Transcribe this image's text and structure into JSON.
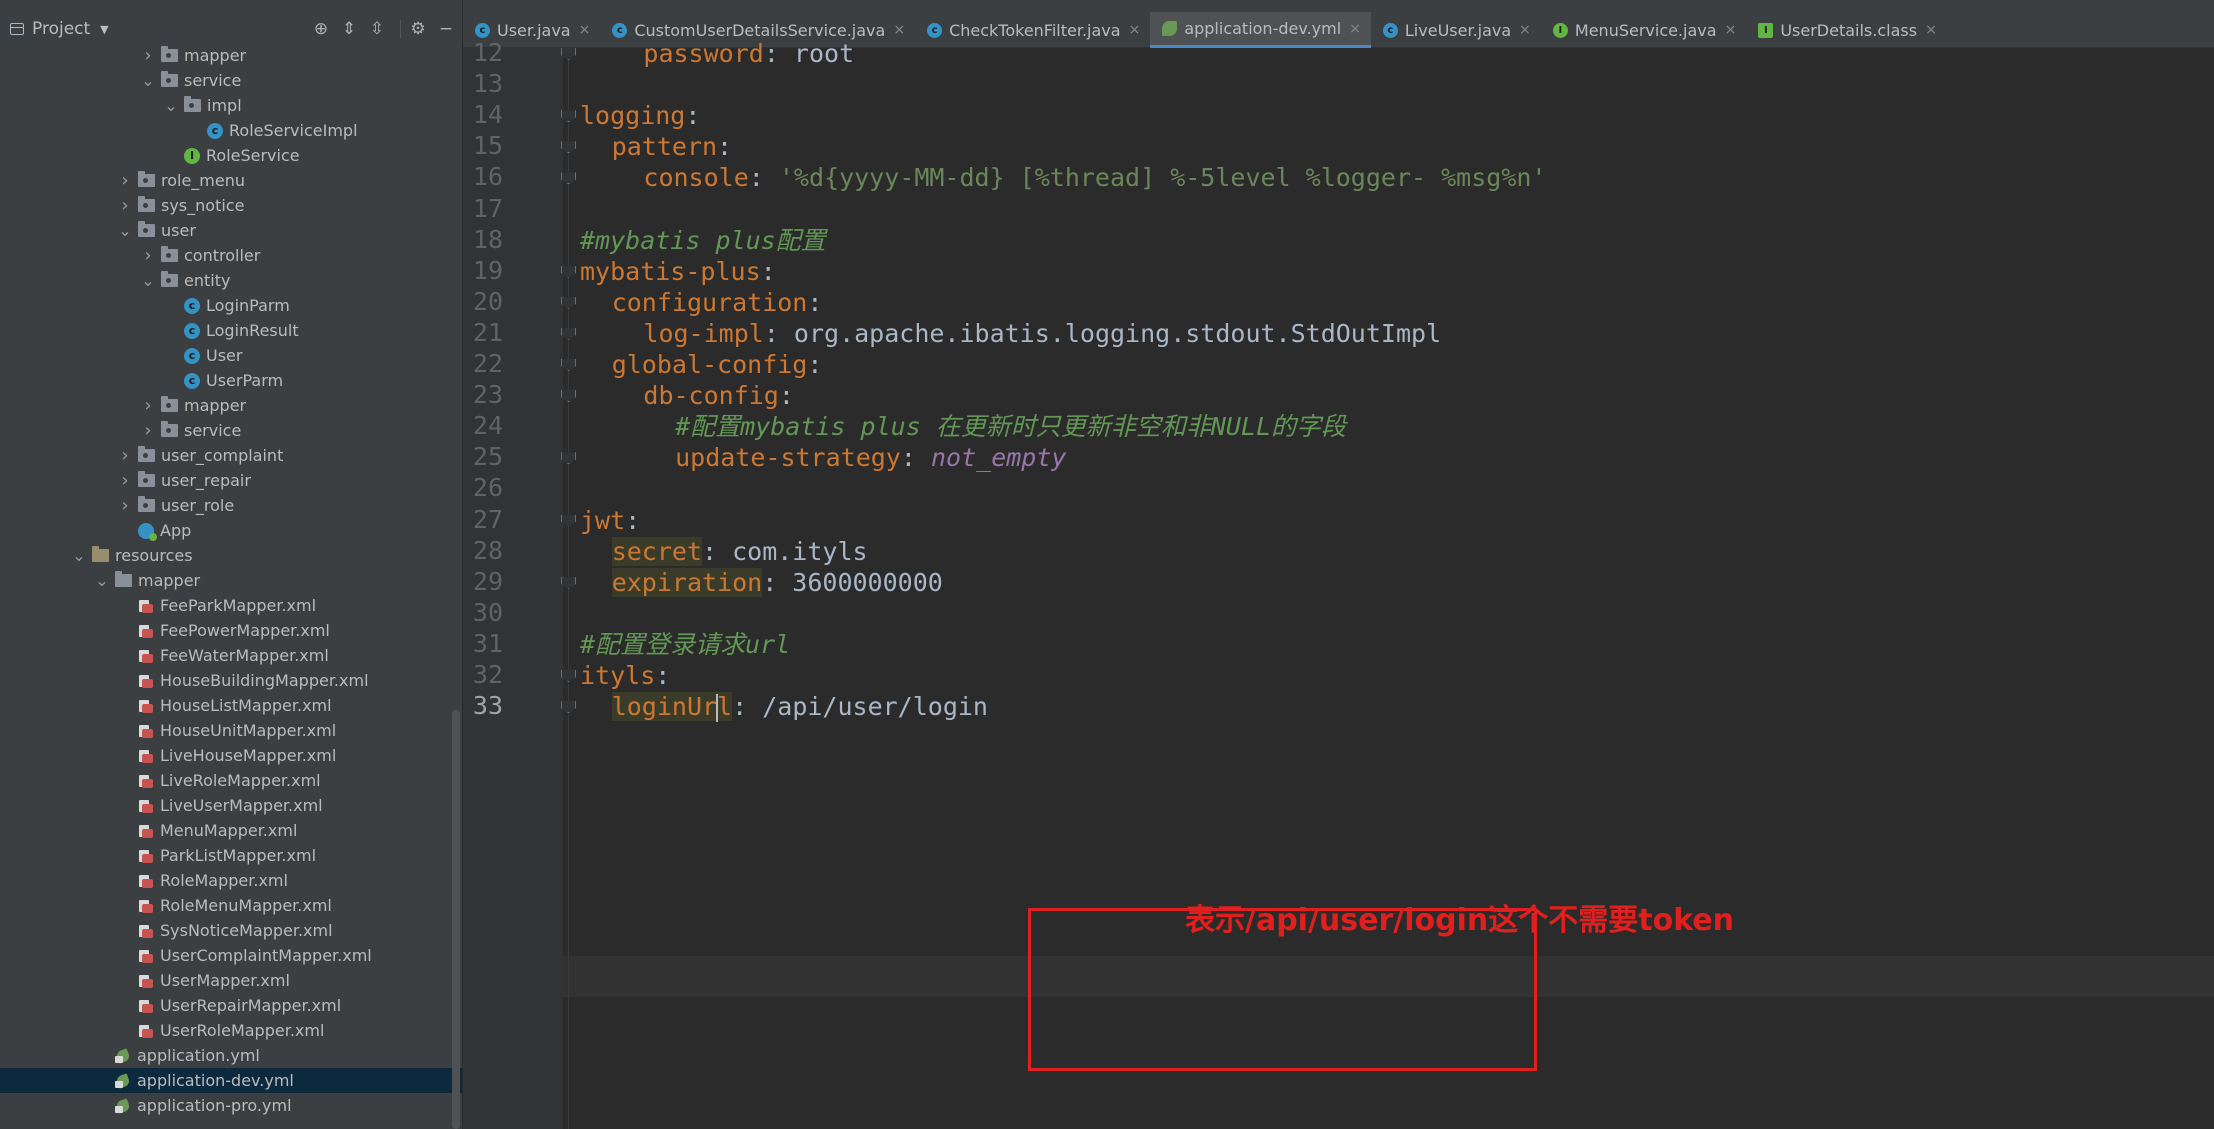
{
  "project_panel": {
    "title": "Project",
    "tools": [
      "crosshair-icon",
      "expand-all-icon",
      "collapse-all-icon",
      "gear-icon",
      "minimize-icon"
    ],
    "tree": [
      {
        "label": "mapper",
        "type": "package",
        "depth": 4,
        "expanded": false
      },
      {
        "label": "service",
        "type": "package",
        "depth": 4,
        "expanded": true
      },
      {
        "label": "impl",
        "type": "package",
        "depth": 5,
        "expanded": true
      },
      {
        "label": "RoleServiceImpl",
        "type": "class",
        "depth": 6
      },
      {
        "label": "RoleService",
        "type": "interface",
        "depth": 5
      },
      {
        "label": "role_menu",
        "type": "package",
        "depth": 3,
        "expanded": false
      },
      {
        "label": "sys_notice",
        "type": "package",
        "depth": 3,
        "expanded": false
      },
      {
        "label": "user",
        "type": "package",
        "depth": 3,
        "expanded": true
      },
      {
        "label": "controller",
        "type": "package",
        "depth": 4,
        "expanded": false
      },
      {
        "label": "entity",
        "type": "package",
        "depth": 4,
        "expanded": true
      },
      {
        "label": "LoginParm",
        "type": "class",
        "depth": 5
      },
      {
        "label": "LoginResult",
        "type": "class",
        "depth": 5
      },
      {
        "label": "User",
        "type": "class",
        "depth": 5
      },
      {
        "label": "UserParm",
        "type": "class",
        "depth": 5
      },
      {
        "label": "mapper",
        "type": "package",
        "depth": 4,
        "expanded": false
      },
      {
        "label": "service",
        "type": "package",
        "depth": 4,
        "expanded": false
      },
      {
        "label": "user_complaint",
        "type": "package",
        "depth": 3,
        "expanded": false
      },
      {
        "label": "user_repair",
        "type": "package",
        "depth": 3,
        "expanded": false
      },
      {
        "label": "user_role",
        "type": "package",
        "depth": 3,
        "expanded": false
      },
      {
        "label": "App",
        "type": "app",
        "depth": 3
      },
      {
        "label": "resources",
        "type": "resources",
        "depth": 1,
        "expanded": true
      },
      {
        "label": "mapper",
        "type": "folder",
        "depth": 2,
        "expanded": true
      },
      {
        "label": "FeeParkMapper.xml",
        "type": "xml",
        "depth": 3
      },
      {
        "label": "FeePowerMapper.xml",
        "type": "xml",
        "depth": 3
      },
      {
        "label": "FeeWaterMapper.xml",
        "type": "xml",
        "depth": 3
      },
      {
        "label": "HouseBuildingMapper.xml",
        "type": "xml",
        "depth": 3
      },
      {
        "label": "HouseListMapper.xml",
        "type": "xml",
        "depth": 3
      },
      {
        "label": "HouseUnitMapper.xml",
        "type": "xml",
        "depth": 3
      },
      {
        "label": "LiveHouseMapper.xml",
        "type": "xml",
        "depth": 3
      },
      {
        "label": "LiveRoleMapper.xml",
        "type": "xml",
        "depth": 3
      },
      {
        "label": "LiveUserMapper.xml",
        "type": "xml",
        "depth": 3
      },
      {
        "label": "MenuMapper.xml",
        "type": "xml",
        "depth": 3
      },
      {
        "label": "ParkListMapper.xml",
        "type": "xml",
        "depth": 3
      },
      {
        "label": "RoleMapper.xml",
        "type": "xml",
        "depth": 3
      },
      {
        "label": "RoleMenuMapper.xml",
        "type": "xml",
        "depth": 3
      },
      {
        "label": "SysNoticeMapper.xml",
        "type": "xml",
        "depth": 3
      },
      {
        "label": "UserComplaintMapper.xml",
        "type": "xml",
        "depth": 3
      },
      {
        "label": "UserMapper.xml",
        "type": "xml",
        "depth": 3
      },
      {
        "label": "UserRepairMapper.xml",
        "type": "xml",
        "depth": 3
      },
      {
        "label": "UserRoleMapper.xml",
        "type": "xml",
        "depth": 3
      },
      {
        "label": "application.yml",
        "type": "yml",
        "depth": 2
      },
      {
        "label": "application-dev.yml",
        "type": "yml",
        "depth": 2,
        "selected": true
      },
      {
        "label": "application-pro.yml",
        "type": "yml",
        "depth": 2
      }
    ]
  },
  "tabs": [
    {
      "label": "User.java",
      "icon": "class"
    },
    {
      "label": "CustomUserDetailsService.java",
      "icon": "class"
    },
    {
      "label": "CheckTokenFilter.java",
      "icon": "class"
    },
    {
      "label": "application-dev.yml",
      "icon": "yml",
      "active": true
    },
    {
      "label": "LiveUser.java",
      "icon": "class"
    },
    {
      "label": "MenuService.java",
      "icon": "interface"
    },
    {
      "label": "UserDetails.class",
      "icon": "classfile"
    }
  ],
  "editor": {
    "current_line": 33,
    "lines": [
      {
        "n": 12,
        "indent": 2,
        "tokens": [
          [
            "k",
            "password"
          ],
          [
            "v",
            ": root"
          ]
        ]
      },
      {
        "n": 13,
        "indent": 0,
        "tokens": []
      },
      {
        "n": 14,
        "indent": 0,
        "tokens": [
          [
            "k",
            "logging"
          ],
          [
            "v",
            ":"
          ]
        ]
      },
      {
        "n": 15,
        "indent": 1,
        "tokens": [
          [
            "k",
            "pattern"
          ],
          [
            "v",
            ":"
          ]
        ]
      },
      {
        "n": 16,
        "indent": 2,
        "tokens": [
          [
            "k",
            "console"
          ],
          [
            "v",
            ": "
          ],
          [
            "s",
            "'%d{yyyy-MM-dd} [%thread] %-5level %logger- %msg%n'"
          ]
        ]
      },
      {
        "n": 17,
        "indent": 0,
        "tokens": []
      },
      {
        "n": 18,
        "indent": 0,
        "tokens": [
          [
            "c",
            "#mybatis plus配置"
          ]
        ]
      },
      {
        "n": 19,
        "indent": 0,
        "tokens": [
          [
            "k",
            "mybatis-plus"
          ],
          [
            "v",
            ":"
          ]
        ]
      },
      {
        "n": 20,
        "indent": 1,
        "tokens": [
          [
            "k",
            "configuration"
          ],
          [
            "v",
            ":"
          ]
        ]
      },
      {
        "n": 21,
        "indent": 2,
        "tokens": [
          [
            "k",
            "log-impl"
          ],
          [
            "v",
            ": org.apache.ibatis.logging.stdout.StdOutImpl"
          ]
        ]
      },
      {
        "n": 22,
        "indent": 1,
        "tokens": [
          [
            "k",
            "global-config"
          ],
          [
            "v",
            ":"
          ]
        ]
      },
      {
        "n": 23,
        "indent": 2,
        "tokens": [
          [
            "k",
            "db-config"
          ],
          [
            "v",
            ":"
          ]
        ]
      },
      {
        "n": 24,
        "indent": 3,
        "tokens": [
          [
            "c",
            "#配置mybatis plus 在更新时只更新非空和非NULL的字段"
          ]
        ]
      },
      {
        "n": 25,
        "indent": 3,
        "tokens": [
          [
            "k",
            "update-strategy"
          ],
          [
            "v",
            ": "
          ],
          [
            "p",
            "not_empty"
          ]
        ]
      },
      {
        "n": 26,
        "indent": 0,
        "tokens": []
      },
      {
        "n": 27,
        "indent": 0,
        "tokens": [
          [
            "k",
            "jwt"
          ],
          [
            "v",
            ":"
          ]
        ]
      },
      {
        "n": 28,
        "indent": 1,
        "tokens": [
          [
            "kh",
            "secret"
          ],
          [
            "v",
            ": com.ityls"
          ]
        ]
      },
      {
        "n": 29,
        "indent": 1,
        "tokens": [
          [
            "kh",
            "expiration"
          ],
          [
            "v",
            ": 3600000000"
          ]
        ]
      },
      {
        "n": 30,
        "indent": 0,
        "tokens": []
      },
      {
        "n": 31,
        "indent": 0,
        "tokens": [
          [
            "c",
            "#配置登录请求url"
          ]
        ]
      },
      {
        "n": 32,
        "indent": 0,
        "tokens": [
          [
            "k",
            "ityls"
          ],
          [
            "v",
            ":"
          ]
        ]
      },
      {
        "n": 33,
        "indent": 1,
        "tokens": [
          [
            "kc",
            "loginUrl"
          ],
          [
            "v",
            ": /api/user/login"
          ]
        ]
      }
    ]
  },
  "annotation": {
    "text": "表示/api/user/login这个不需要token",
    "color": "#e0201e"
  }
}
